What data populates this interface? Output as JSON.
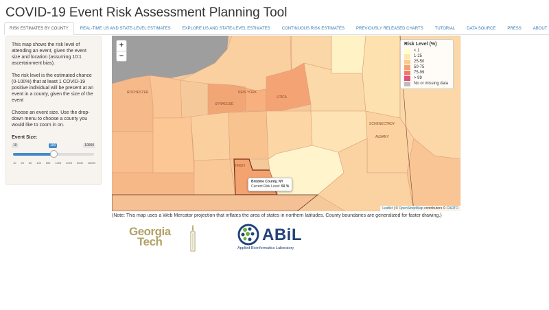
{
  "app": {
    "title": "COVID-19 Event Risk Assessment Planning Tool"
  },
  "tabs": [
    {
      "label": "RISK ESTIMATES BY COUNTY",
      "active": true
    },
    {
      "label": "REAL-TIME US AND STATE-LEVEL ESTIMATES",
      "active": false
    },
    {
      "label": "EXPLORE US AND STATE-LEVEL ESTIMATES",
      "active": false
    },
    {
      "label": "CONTINUOUS RISK ESTIMATES",
      "active": false
    },
    {
      "label": "PREVIOUSLY RELEASED CHARTS",
      "active": false
    },
    {
      "label": "TUTORIAL",
      "active": false
    },
    {
      "label": "DATA SOURCE",
      "active": false
    },
    {
      "label": "PRESS",
      "active": false
    },
    {
      "label": "ABOUT",
      "active": false
    }
  ],
  "sidebar": {
    "p1": "This map shows the risk level of attending an event, given the event size and location (assuming 10:1 ascertainment bias).",
    "p2": "The risk level is the estimated chance (0-100%) that at least 1 COVID-19 positive individual will be present at an event in a county, given the size of the event",
    "p3": "Choose an event size. Use the drop-down menu to choose a county you would like to zoom in on.",
    "event_size_label": "Event Size:",
    "slider": {
      "min": "10",
      "max": "10000",
      "value": "100",
      "ticks": [
        "10",
        "25",
        "50",
        "100",
        "500",
        "1000",
        "2000",
        "5000",
        "10000"
      ]
    }
  },
  "map": {
    "zoom_in": "+",
    "zoom_out": "−",
    "city_labels": [
      "ROCHESTER",
      "SYRACUSE",
      "NEW YORK",
      "UTICA",
      "SCHENECTADY",
      "ALBANY",
      "BINGH"
    ],
    "legend": {
      "title": "Risk Level (%)",
      "items": [
        {
          "label": "< 1",
          "color": "#ffffcc"
        },
        {
          "label": "1-25",
          "color": "#fee8b0"
        },
        {
          "label": "25-50",
          "color": "#fdca8a"
        },
        {
          "label": "50-75",
          "color": "#f8a070"
        },
        {
          "label": "75-99",
          "color": "#f07a6c"
        },
        {
          "label": "> 99",
          "color": "#e3507a"
        },
        {
          "label": "No or missing data",
          "color": "#bdbdbd"
        }
      ]
    },
    "tooltip": {
      "county": "Broome County, NY",
      "risk_label": "Current Risk Level:",
      "risk_value": "50 %"
    },
    "attribution": {
      "leaflet": "Leaflet",
      "sep": " | © ",
      "osm": "OpenStreetMap",
      "contrib": " contributors © ",
      "carto": "CARTO"
    }
  },
  "note": "(Note: This map uses a Web Mercator projection that inflates the area of states in northern latitudes. County boundaries are generalized for faster drawing.)",
  "logos": {
    "gt_line1": "Georgia",
    "gt_line2": "Tech",
    "abil_word": "ABiL",
    "abil_sub": "Applied Bioinformatics Laboratory"
  }
}
